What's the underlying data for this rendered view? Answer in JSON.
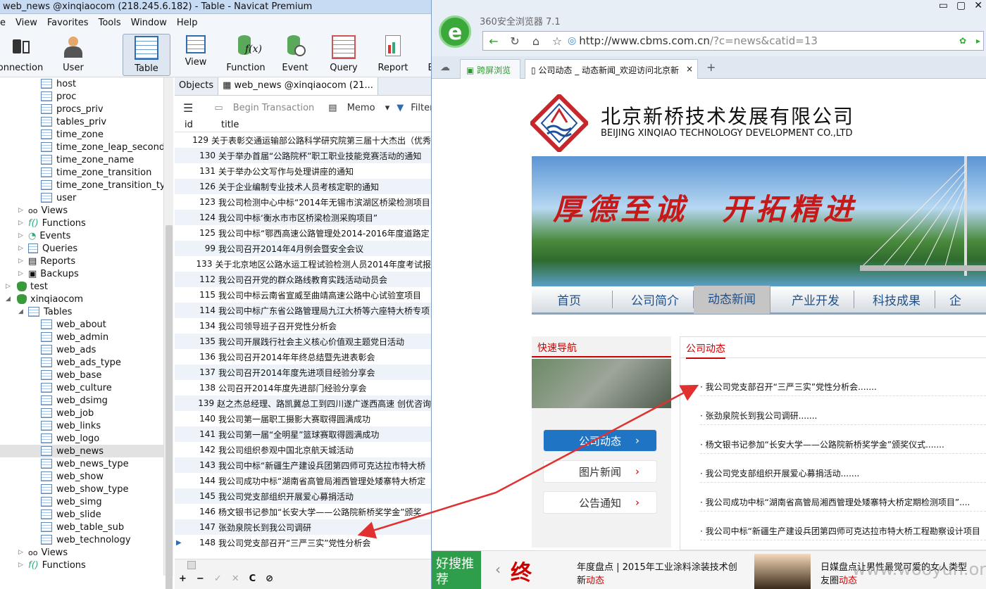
{
  "navicat": {
    "title": "web_news @xinqiaocom (218.245.6.182) - Table - Navicat Premium",
    "menu": [
      "e",
      "View",
      "Favorites",
      "Tools",
      "Window",
      "Help"
    ],
    "toolbar": [
      "onnection",
      "User",
      "Table",
      "View",
      "Function",
      "Event",
      "Query",
      "Report",
      "B"
    ],
    "tree": [
      "host",
      "proc",
      "procs_priv",
      "tables_priv",
      "time_zone",
      "time_zone_leap_second",
      "time_zone_name",
      "time_zone_transition",
      "time_zone_transition_type",
      "user",
      "Views",
      "Functions",
      "Events",
      "Queries",
      "Reports",
      "Backups",
      "test",
      "xinqiaocom",
      "Tables",
      "web_about",
      "web_admin",
      "web_ads",
      "web_ads_type",
      "web_base",
      "web_culture",
      "web_dsimg",
      "web_job",
      "web_links",
      "web_logo",
      "web_news",
      "web_news_type",
      "web_show",
      "web_show_type",
      "web_simg",
      "web_slide",
      "web_table_sub",
      "web_technology",
      "Views",
      "Functions"
    ],
    "tabs": [
      "Objects",
      "web_news @xinqiaocom (21..."
    ],
    "grid_toolbar": [
      "Begin Transaction",
      "Memo",
      "Filter"
    ],
    "columns": [
      "id",
      "title"
    ],
    "rows": [
      [
        "129",
        "关于表彰交通运输部公路科学研究院第三届十大杰出（优秀"
      ],
      [
        "130",
        "关于举办首届“公路院杯”职工职业技能竞赛活动的通知"
      ],
      [
        "131",
        "关于举办公文写作与处理讲座的通知"
      ],
      [
        "126",
        "关于企业编制专业技术人员考核定职的通知"
      ],
      [
        "123",
        "我公司检测中心中标“2014年无锡市滨湖区桥梁检测项目"
      ],
      [
        "124",
        "我公司中标‘衡水市市区桥梁检测采购项目”"
      ],
      [
        "125",
        "我公司中标“鄂西高速公路管理处2014-2016年度道路定"
      ],
      [
        "99",
        "我公司召开2014年4月例会暨安全会议"
      ],
      [
        "133",
        "关于北京地区公路水运工程试验检测人员2014年度考试报"
      ],
      [
        "112",
        "我公司召开党的群众路线教育实践活动动员会"
      ],
      [
        "115",
        "我公司中标云南省宣威至曲靖高速公路中心试验室项目"
      ],
      [
        "114",
        "我公司中标广东省公路管理局九江大桥等六座特大桥专项"
      ],
      [
        "134",
        "我公司领导班子召开党性分析会"
      ],
      [
        "135",
        "我公司开展践行社会主义核心价值观主题党日活动"
      ],
      [
        "136",
        "我公司召开2014年年终总结暨先进表彰会"
      ],
      [
        "137",
        "我公司召开2014年度先进项目经验分享会"
      ],
      [
        "138",
        "公司召开2014年度先进部门经验分享会"
      ],
      [
        "139",
        "赵之杰总经理、路凯冀总工到四川遂广遂西高速 创优咨询"
      ],
      [
        "140",
        "我公司第一届职工摄影大赛取得圆满成功"
      ],
      [
        "141",
        "我公司第一届“全明星”篮球赛取得圆满成功"
      ],
      [
        "142",
        "我公司组织参观中国北京航天城活动"
      ],
      [
        "143",
        "我公司中标“新疆生产建设兵团第四师可克达拉市特大桥"
      ],
      [
        "144",
        "我公司成功中标“湖南省高管局湘西管理处矮寨特大桥定"
      ],
      [
        "145",
        "我公司党支部组织开展爱心募捐活动"
      ],
      [
        "146",
        "杨文银书记参加“长安大学——公路院新桥奖学金”颁奖"
      ],
      [
        "147",
        "张劲泉院长到我公司调研"
      ],
      [
        "148",
        "我公司党支部召开“三严三实”党性分析会"
      ]
    ],
    "grid_bottom": [
      "+",
      "−",
      "✓",
      "✕",
      "C",
      "⊘"
    ]
  },
  "browser": {
    "app_name": "360安全浏览器 7.1",
    "url_host": "http://www.cbms.com.cn",
    "url_path": "/?c=news&catid=13",
    "tab_left": "跨屏浏览",
    "tab_main": "公司动态 _ 动态新闻_欢迎访问北京新",
    "site": {
      "name_cn": "北京新桥技术发展有限公司",
      "name_en": "BEIJING XINQIAO TECHNOLOGY DEVELOPMENT CO.,LTD",
      "slogan": "厚德至诚　开拓精进",
      "nav": [
        "首页",
        "公司简介",
        "动态新闻",
        "产业开发",
        "科技成果",
        "企"
      ],
      "quick_title": "快速导航",
      "quick_buttons": [
        "公司动态",
        "图片新闻",
        "公告通知"
      ],
      "news_title": "公司动态",
      "news": [
        "· 我公司党支部召开“三严三实”党性分析会.......",
        "· 张劲泉院长到我公司调研.......",
        "· 杨文银书记参加“长安大学——公路院新桥奖学金”颁奖仪式.......",
        "· 我公司党支部组织开展爱心募捐活动.......",
        "· 我公司成功中标“湖南省高管局湘西管理处矮寨特大桥定期检测项目”....",
        "· 我公司中标“新疆生产建设兵团第四师可克达拉市特大桥工程勘察设计项目"
      ]
    },
    "ads": {
      "logo": "好搜推荐",
      "ad1_a": "年度盘点 | 2015年工业涂料涂装技术创",
      "ad1_b": "新",
      "ad1_r": "动态",
      "ad2_a": "日媒盘点让男性最觉可爱的女人类型",
      "ad2_b": "友圈",
      "ad2_r": "动态"
    },
    "watermark": "www.wooyun.org"
  }
}
